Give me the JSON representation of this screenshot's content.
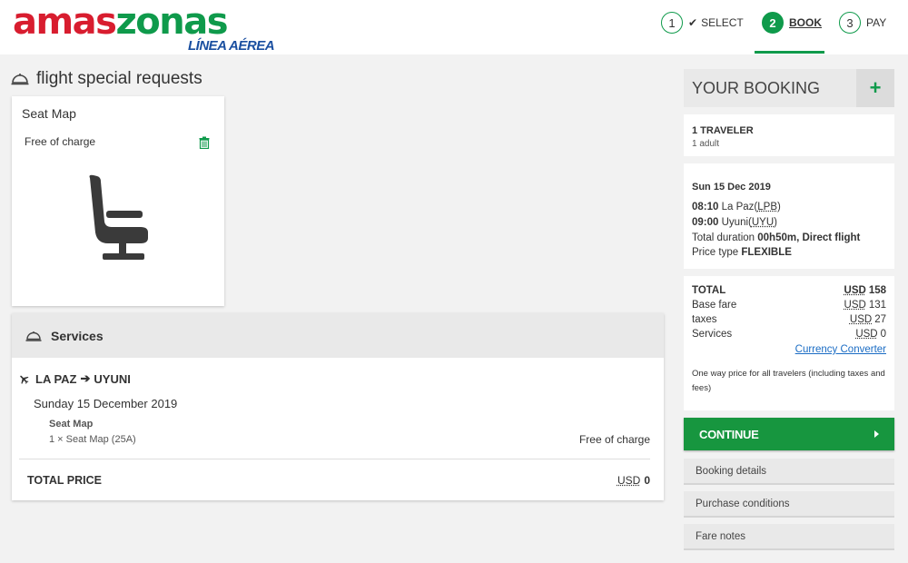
{
  "brand": {
    "name_part1": "amas",
    "name_part2": "zonas",
    "tagline": "LÍNEA AÉREA",
    "colors": {
      "red": "#d81d2f",
      "green": "#0f9a4b",
      "blue": "#1a4fa0"
    }
  },
  "steps": [
    {
      "number": "1",
      "label": "SELECT",
      "state": "done"
    },
    {
      "number": "2",
      "label": "BOOK",
      "state": "active"
    },
    {
      "number": "3",
      "label": "PAY",
      "state": "pending"
    }
  ],
  "page": {
    "title": "flight special requests",
    "title_icon": "service-bell-icon"
  },
  "seat_card": {
    "title": "Seat Map",
    "price_label": "Free of charge",
    "delete_icon": "trash-icon",
    "image_icon": "seat-icon"
  },
  "services": {
    "title": "Services",
    "route_from": "LA PAZ",
    "route_to": "UYUNI",
    "date": "Sunday 15 December 2019",
    "item_name": "Seat Map",
    "item_detail": "1 × Seat Map (25A)",
    "item_price": "Free of charge",
    "total_label": "TOTAL PRICE",
    "total_currency": "USD",
    "total_amount": "0"
  },
  "booking": {
    "title": "YOUR BOOKING",
    "expand_icon": "plus-icon",
    "travelers_title": "1 TRAVELER",
    "travelers_detail": "1 adult",
    "flight_date": "Sun 15 Dec 2019",
    "dep_time": "08:10",
    "dep_city": "La Paz(",
    "dep_code": "LPB",
    "arr_time": "09:00",
    "arr_city": "Uyuni(",
    "arr_code": "UYU",
    "close_paren": ")",
    "duration_label": "Total duration",
    "duration_value": "00h50m, Direct flight",
    "price_type_label": "Price type",
    "price_type_value": "FLEXIBLE",
    "price_rows": [
      {
        "label": "TOTAL",
        "currency": "USD",
        "amount": "158"
      },
      {
        "label": "Base fare",
        "currency": "USD",
        "amount": "131"
      },
      {
        "label": "taxes",
        "currency": "USD",
        "amount": "27"
      },
      {
        "label": "Services",
        "currency": "USD",
        "amount": "0"
      }
    ],
    "currency_converter": "Currency Converter",
    "price_note": "One way price for all travelers (including taxes and fees)",
    "continue_label": "CONTINUE",
    "links": [
      "Booking details",
      "Purchase conditions",
      "Fare notes"
    ]
  }
}
